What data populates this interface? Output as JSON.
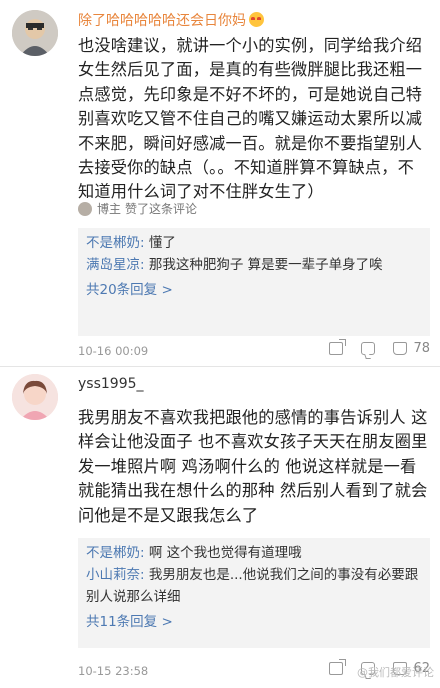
{
  "comments": [
    {
      "username": "除了哈哈哈哈哈还会日你妈",
      "text": "也没啥建议，就讲一个小的实例，同学给我介绍女生然后见了面，是真的有些微胖腿比我还粗一点感觉，先印象是不好不坏的，可是她说自己特别喜欢吃又管不住自己的嘴又嫌运动太累所以减不来肥，瞬间好感减一百。就是你不要指望别人去接受你的缺点（。。不知道胖算不算缺点，不知道用什么词了对不住胖女生了）",
      "author_like": {
        "author": "博主",
        "label": "赞了这条评论"
      },
      "replies": [
        {
          "name": "不是郴奶:",
          "text": " 懂了"
        },
        {
          "name": "满岛星凉:",
          "text": " 那我这种肥狗子 算是要一辈子单身了唉"
        }
      ],
      "more": "共20条回复 >",
      "time": "10-16 00:09",
      "likes": "78"
    },
    {
      "username": "yss1995_",
      "text": "我男朋友不喜欢我把跟他的感情的事告诉别人 这样会让他没面子 也不喜欢女孩子天天在朋友圈里发一堆照片啊 鸡汤啊什么的 他说这样就是一看就能猜出我在想什么的那种 然后别人看到了就会问他是不是又跟我怎么了",
      "replies": [
        {
          "name": "不是郴奶:",
          "text": " 啊 这个我也觉得有道理哦"
        },
        {
          "name": "小山莉奈:",
          "text": " 我男朋友也是...他说我们之间的事没有必要跟别人说那么详细"
        }
      ],
      "more": "共11条回复 >",
      "time": "10-15 23:58",
      "likes": "62"
    }
  ],
  "watermark": "@我们都爱评论"
}
